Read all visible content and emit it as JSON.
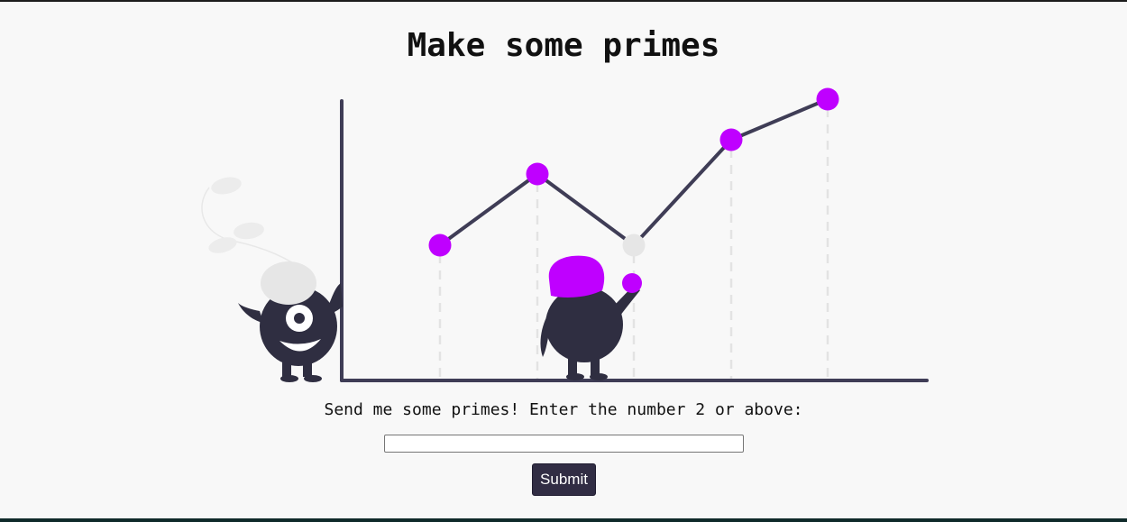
{
  "page": {
    "title": "Make some primes"
  },
  "form": {
    "prompt": "Send me some primes! Enter the number 2 or above:",
    "input_value": "",
    "submit_label": "Submit"
  },
  "colors": {
    "accent": "#bf00ff",
    "dark": "#2f2e41",
    "light_gray": "#e6e6e6",
    "button": "#312d44"
  }
}
